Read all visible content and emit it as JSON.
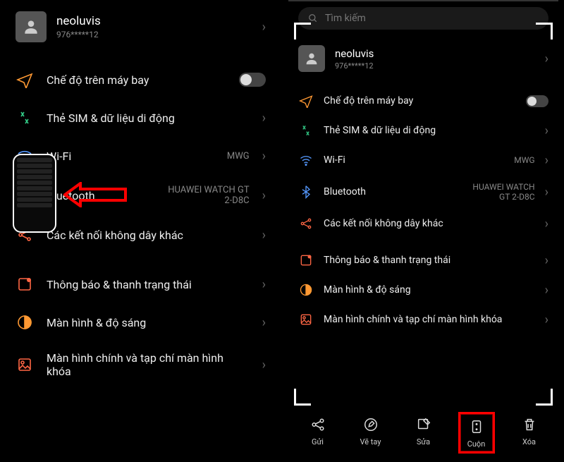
{
  "left": {
    "profile": {
      "name": "neoluvis",
      "phone": "976*****12"
    },
    "items": [
      {
        "k": "airplane",
        "label": "Chế độ trên máy bay",
        "toggle": true
      },
      {
        "k": "sim",
        "label": "Thẻ SIM & dữ liệu di động"
      },
      {
        "k": "wifi",
        "label": "Wi-Fi",
        "value": "MWG"
      },
      {
        "k": "bt",
        "label": "Bluetooth",
        "value": "HUAWEI WATCH GT 2-D8C"
      },
      {
        "k": "other",
        "label": "Các kết nối không dây khác"
      }
    ],
    "items2": [
      {
        "k": "notif",
        "label": "Thông báo & thanh trạng thái"
      },
      {
        "k": "display",
        "label": "Màn hình & độ sáng"
      },
      {
        "k": "home",
        "label": "Màn hình chính và tạp chí màn hình khóa"
      }
    ]
  },
  "right": {
    "search_placeholder": "Tìm kiếm",
    "profile": {
      "name": "neoluvis",
      "phone": "976*****12"
    },
    "items": [
      {
        "k": "airplane",
        "label": "Chế độ trên máy bay",
        "toggle": true
      },
      {
        "k": "sim",
        "label": "Thẻ SIM & dữ liệu di động"
      },
      {
        "k": "wifi",
        "label": "Wi-Fi",
        "value": "MWG"
      },
      {
        "k": "bt",
        "label": "Bluetooth",
        "value": "HUAWEI WATCH GT 2-D8C"
      },
      {
        "k": "other",
        "label": "Các kết nối không dây khác"
      }
    ],
    "items2": [
      {
        "k": "notif",
        "label": "Thông báo & thanh trạng thái"
      },
      {
        "k": "display",
        "label": "Màn hình & độ sáng"
      },
      {
        "k": "home",
        "label": "Màn hình chính và tạp chí màn hình khóa"
      }
    ],
    "toolbar": [
      {
        "k": "share",
        "label": "Gửi"
      },
      {
        "k": "draw",
        "label": "Vẽ tay"
      },
      {
        "k": "edit",
        "label": "Sửa"
      },
      {
        "k": "scroll",
        "label": "Cuộn",
        "highlight": true
      },
      {
        "k": "delete",
        "label": "Xóa"
      }
    ]
  }
}
